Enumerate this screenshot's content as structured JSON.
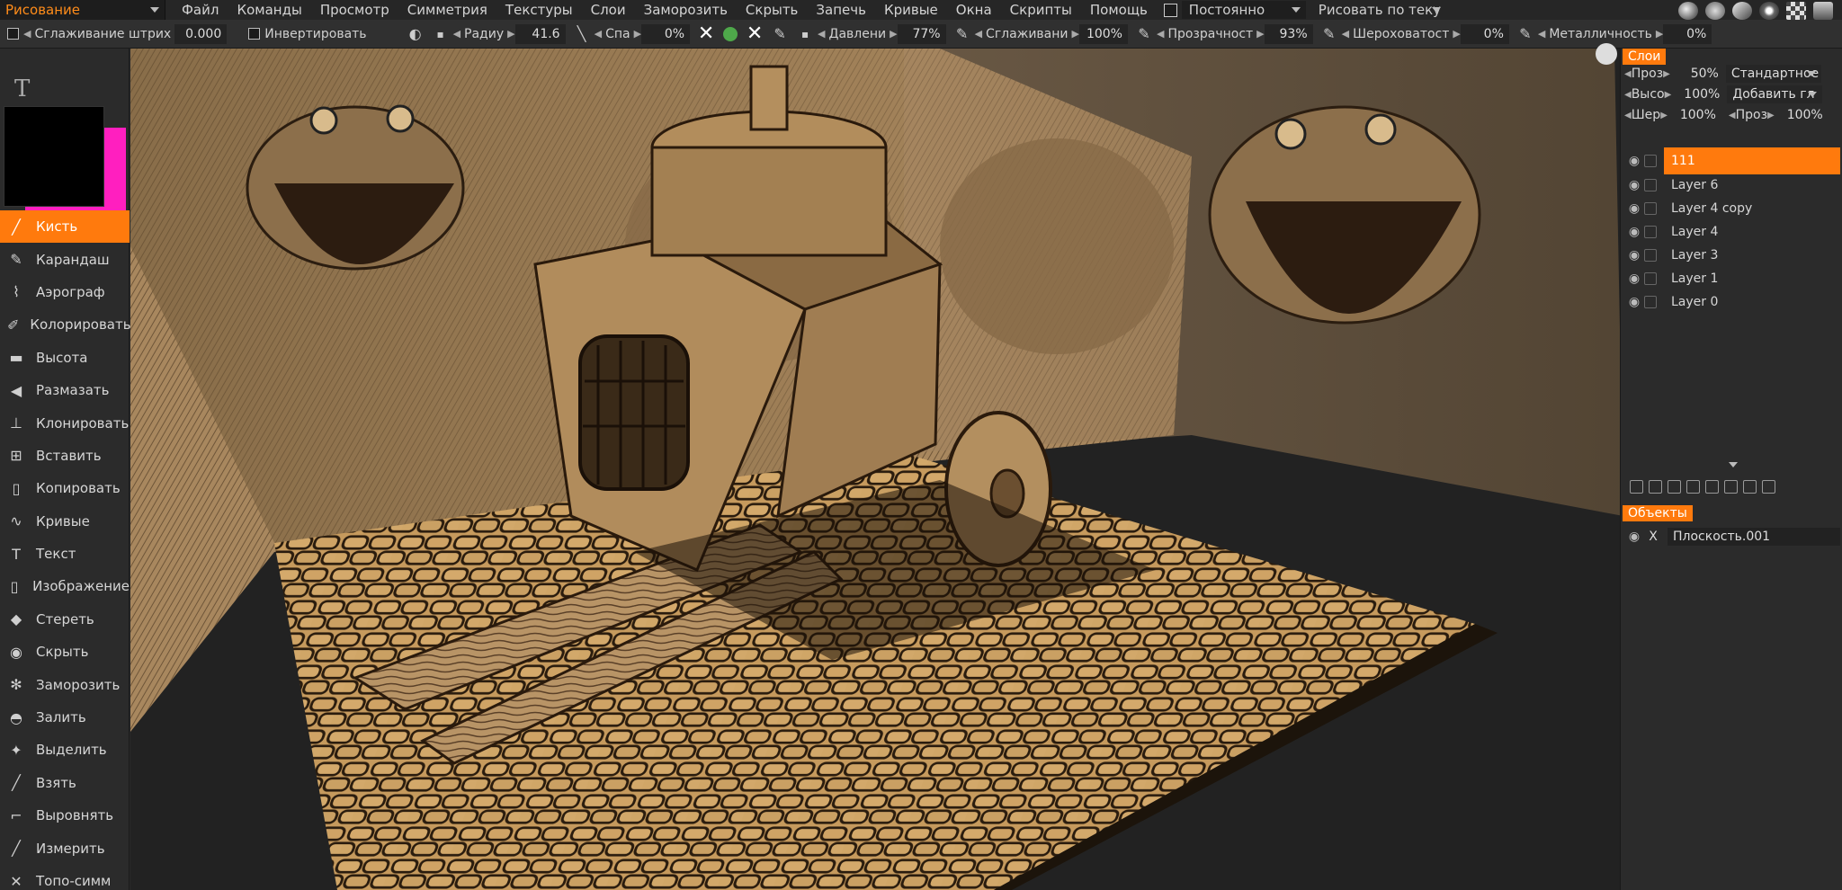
{
  "menubar": {
    "room": "Рисование",
    "items": [
      "Файл",
      "Команды",
      "Просмотр",
      "Симметрия",
      "Текстуры",
      "Слои",
      "Заморозить",
      "Скрыть",
      "Запечь",
      "Кривые",
      "Окна",
      "Скрипты",
      "Помощь"
    ],
    "constant_label": "Постоянно",
    "paint_mode": "Рисовать по теку"
  },
  "toolopts": {
    "smooth_stroke_label": "Сглаживание штрих",
    "smooth_stroke_value": "0.000",
    "invert_label": "Инвертировать",
    "radius_label": "Радиу",
    "radius_value": "41.6",
    "falloff_label": "Спа",
    "falloff_value": "0%",
    "pressure_label": "Давлени",
    "pressure_value": "77%",
    "smoothing_label": "Сглаживани",
    "smoothing_value": "100%",
    "opacity_label": "Прозрачност",
    "opacity_value": "93%",
    "roughness_label": "Шероховатост",
    "roughness_value": "0%",
    "metal_label": "Металличность",
    "metal_value": "0%"
  },
  "tools": [
    {
      "label": "Кисть",
      "icon": "brush-icon",
      "glyph": "╱"
    },
    {
      "label": "Карандаш",
      "icon": "pencil-icon",
      "glyph": "✎"
    },
    {
      "label": "Аэрограф",
      "icon": "airbrush-icon",
      "glyph": "⌇"
    },
    {
      "label": "Колорировать",
      "icon": "colorize-icon",
      "glyph": "✐"
    },
    {
      "label": "Высота",
      "icon": "height-icon",
      "glyph": "▬"
    },
    {
      "label": "Размазать",
      "icon": "smudge-icon",
      "glyph": "◀"
    },
    {
      "label": "Клонировать",
      "icon": "clone-icon",
      "glyph": "⊥"
    },
    {
      "label": "Вставить",
      "icon": "insert-icon",
      "glyph": "⊞"
    },
    {
      "label": "Копировать",
      "icon": "copy-icon",
      "glyph": "▯"
    },
    {
      "label": "Кривые",
      "icon": "curves-icon",
      "glyph": "∿"
    },
    {
      "label": "Текст",
      "icon": "text-icon",
      "glyph": "T"
    },
    {
      "label": "Изображение",
      "icon": "image-icon",
      "glyph": "▯"
    },
    {
      "label": "Стереть",
      "icon": "eraser-icon",
      "glyph": "◆"
    },
    {
      "label": "Скрыть",
      "icon": "hide-icon",
      "glyph": "◉"
    },
    {
      "label": "Заморозить",
      "icon": "freeze-icon",
      "glyph": "✻"
    },
    {
      "label": "Залить",
      "icon": "fill-icon",
      "glyph": "◓"
    },
    {
      "label": "Выделить",
      "icon": "select-icon",
      "glyph": "✦"
    },
    {
      "label": "Взять",
      "icon": "picker-icon",
      "glyph": "╱"
    },
    {
      "label": "Выровнять",
      "icon": "flatten-icon",
      "glyph": "⌐"
    },
    {
      "label": "Измерить",
      "icon": "measure-icon",
      "glyph": "╱"
    },
    {
      "label": "Топо-симм",
      "icon": "topo-symmetry-icon",
      "glyph": "✕"
    }
  ],
  "colors": {
    "accent": "#ff7a0d",
    "primary_color": "#000000",
    "secondary_color": "#ff1fbf"
  },
  "layers_panel": {
    "tab": "Слои",
    "opacity_label": "Проз",
    "opacity_value": "50%",
    "blend_mode": "Стандартное",
    "height_label": "Высо",
    "height_value": "100%",
    "height_mode": "Добавить гл",
    "rough_label": "Шер",
    "rough_value": "100%",
    "transp_label": "Проз",
    "transp_value": "100%",
    "layers": [
      "111",
      "Layer 6",
      "Layer 4 copy",
      "Layer 4",
      "Layer 3",
      "Layer 1",
      "Layer 0"
    ]
  },
  "objects_panel": {
    "tab": "Объекты",
    "objects": [
      "Плоскость.001"
    ]
  }
}
